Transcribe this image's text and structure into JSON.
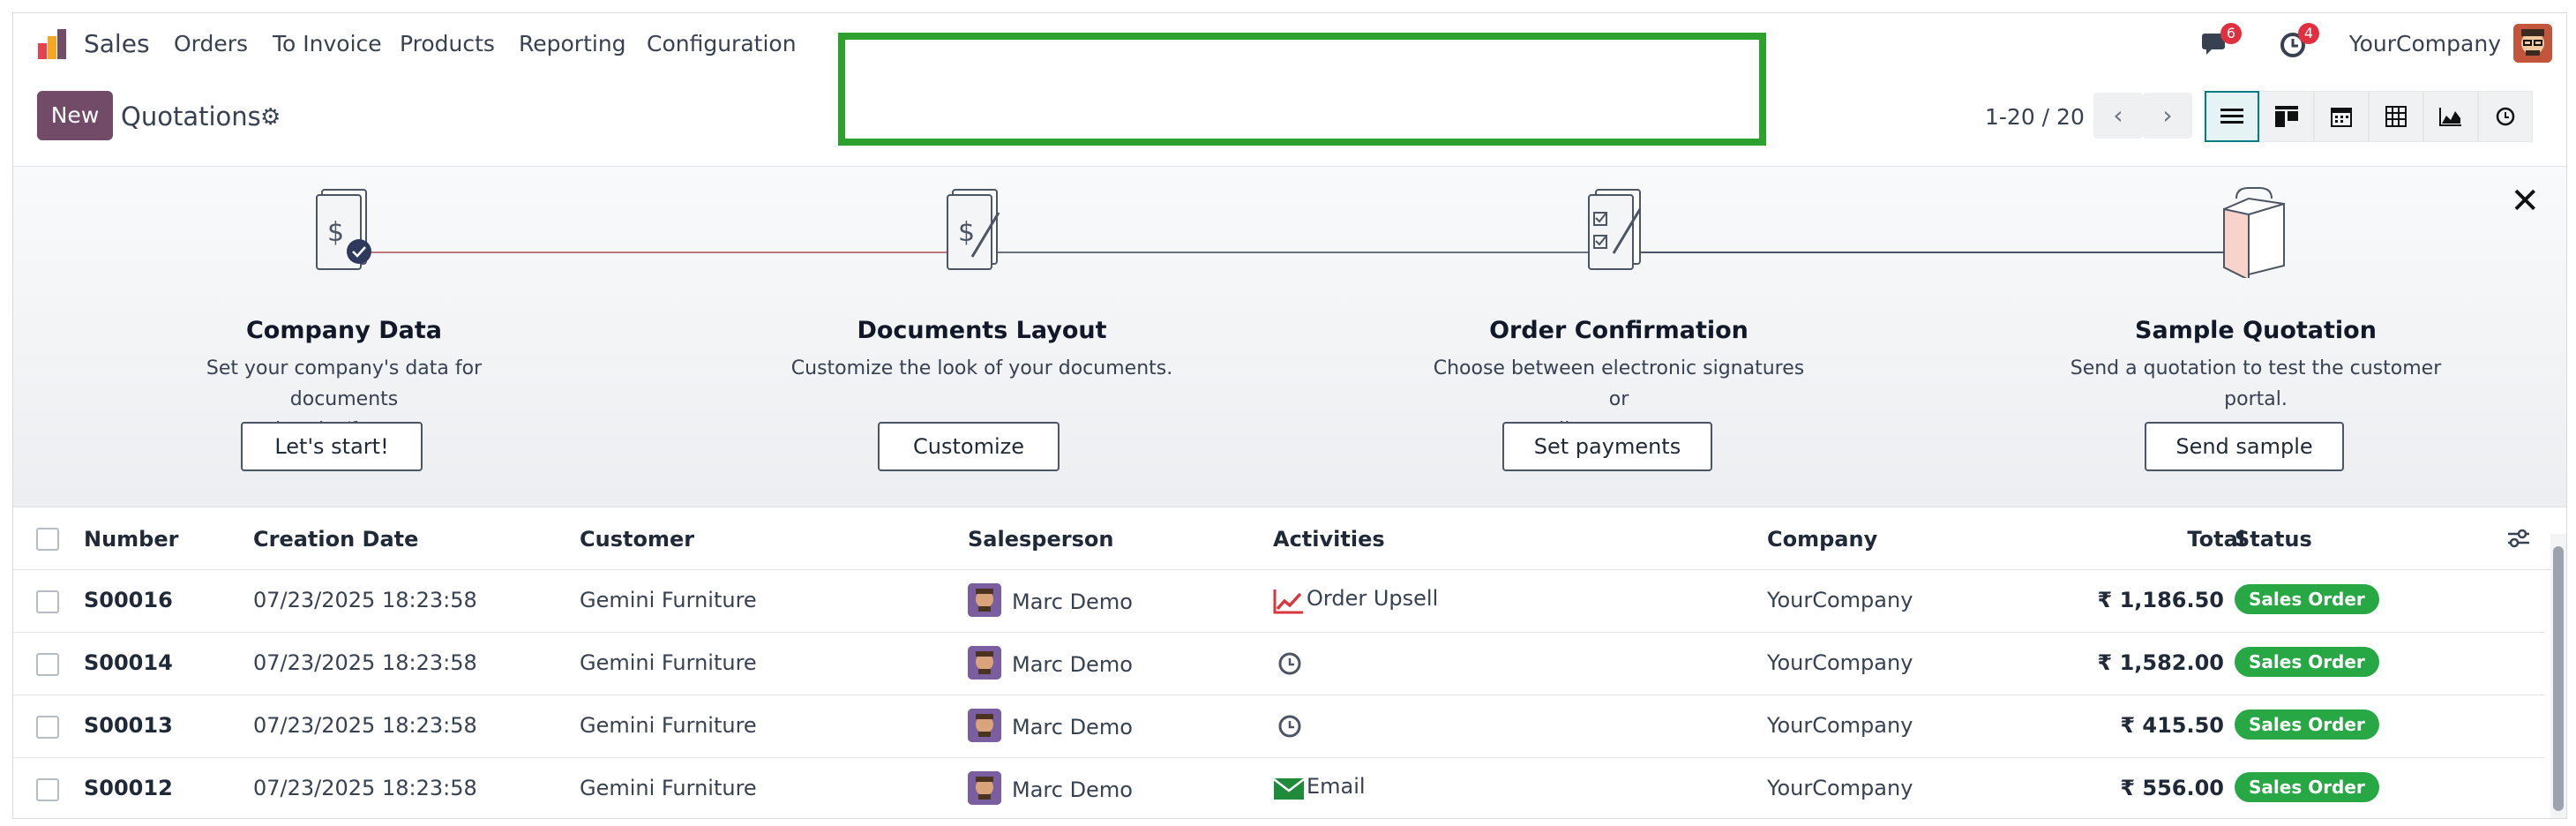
{
  "navbar": {
    "app_name": "Sales",
    "menu": [
      "Orders",
      "To Invoice",
      "Products",
      "Reporting",
      "Configuration"
    ],
    "messages_count": "6",
    "activities_count": "4",
    "company": "YourCompany"
  },
  "control_panel": {
    "new_label": "New",
    "breadcrumb": "Quotations",
    "pager": "1-20 / 20"
  },
  "onboarding": {
    "steps": [
      {
        "title": "Company Data",
        "desc_line1": "Set your company's data for documents",
        "desc_line2": "header/footer.",
        "button": "Let's start!"
      },
      {
        "title": "Documents Layout",
        "desc_line1": "Customize the look of your documents.",
        "desc_line2": "",
        "button": "Customize"
      },
      {
        "title": "Order Confirmation",
        "desc_line1": "Choose between electronic signatures or",
        "desc_line2": "online payments.",
        "button": "Set payments"
      },
      {
        "title": "Sample Quotation",
        "desc_line1": "Send a quotation to test the customer",
        "desc_line2": "portal.",
        "button": "Send sample"
      }
    ]
  },
  "table": {
    "headers": {
      "number": "Number",
      "creation_date": "Creation Date",
      "customer": "Customer",
      "salesperson": "Salesperson",
      "activities": "Activities",
      "company": "Company",
      "total": "Total",
      "status": "Status"
    },
    "rows": [
      {
        "number": "S00016",
        "date": "07/23/2025 18:23:58",
        "customer": "Gemini Furniture",
        "salesperson": "Marc Demo",
        "activity": "Order Upsell",
        "activity_icon": "trend-up-icon",
        "company": "YourCompany",
        "total": "₹ 1,186.50",
        "status": "Sales Order"
      },
      {
        "number": "S00014",
        "date": "07/23/2025 18:23:58",
        "customer": "Gemini Furniture",
        "salesperson": "Marc Demo",
        "activity": "",
        "activity_icon": "clock-icon",
        "company": "YourCompany",
        "total": "₹ 1,582.00",
        "status": "Sales Order"
      },
      {
        "number": "S00013",
        "date": "07/23/2025 18:23:58",
        "customer": "Gemini Furniture",
        "salesperson": "Marc Demo",
        "activity": "",
        "activity_icon": "clock-icon",
        "company": "YourCompany",
        "total": "₹ 415.50",
        "status": "Sales Order"
      },
      {
        "number": "S00012",
        "date": "07/23/2025 18:23:58",
        "customer": "Gemini Furniture",
        "salesperson": "Marc Demo",
        "activity": "Email",
        "activity_icon": "envelope-icon",
        "company": "YourCompany",
        "total": "₹ 556.00",
        "status": "Sales Order"
      }
    ]
  },
  "colors": {
    "brand": "#714b67",
    "status_green": "#28a745",
    "highlight": "#2ea02e",
    "badge_red": "#e0303f",
    "active_view": "#017e84"
  }
}
